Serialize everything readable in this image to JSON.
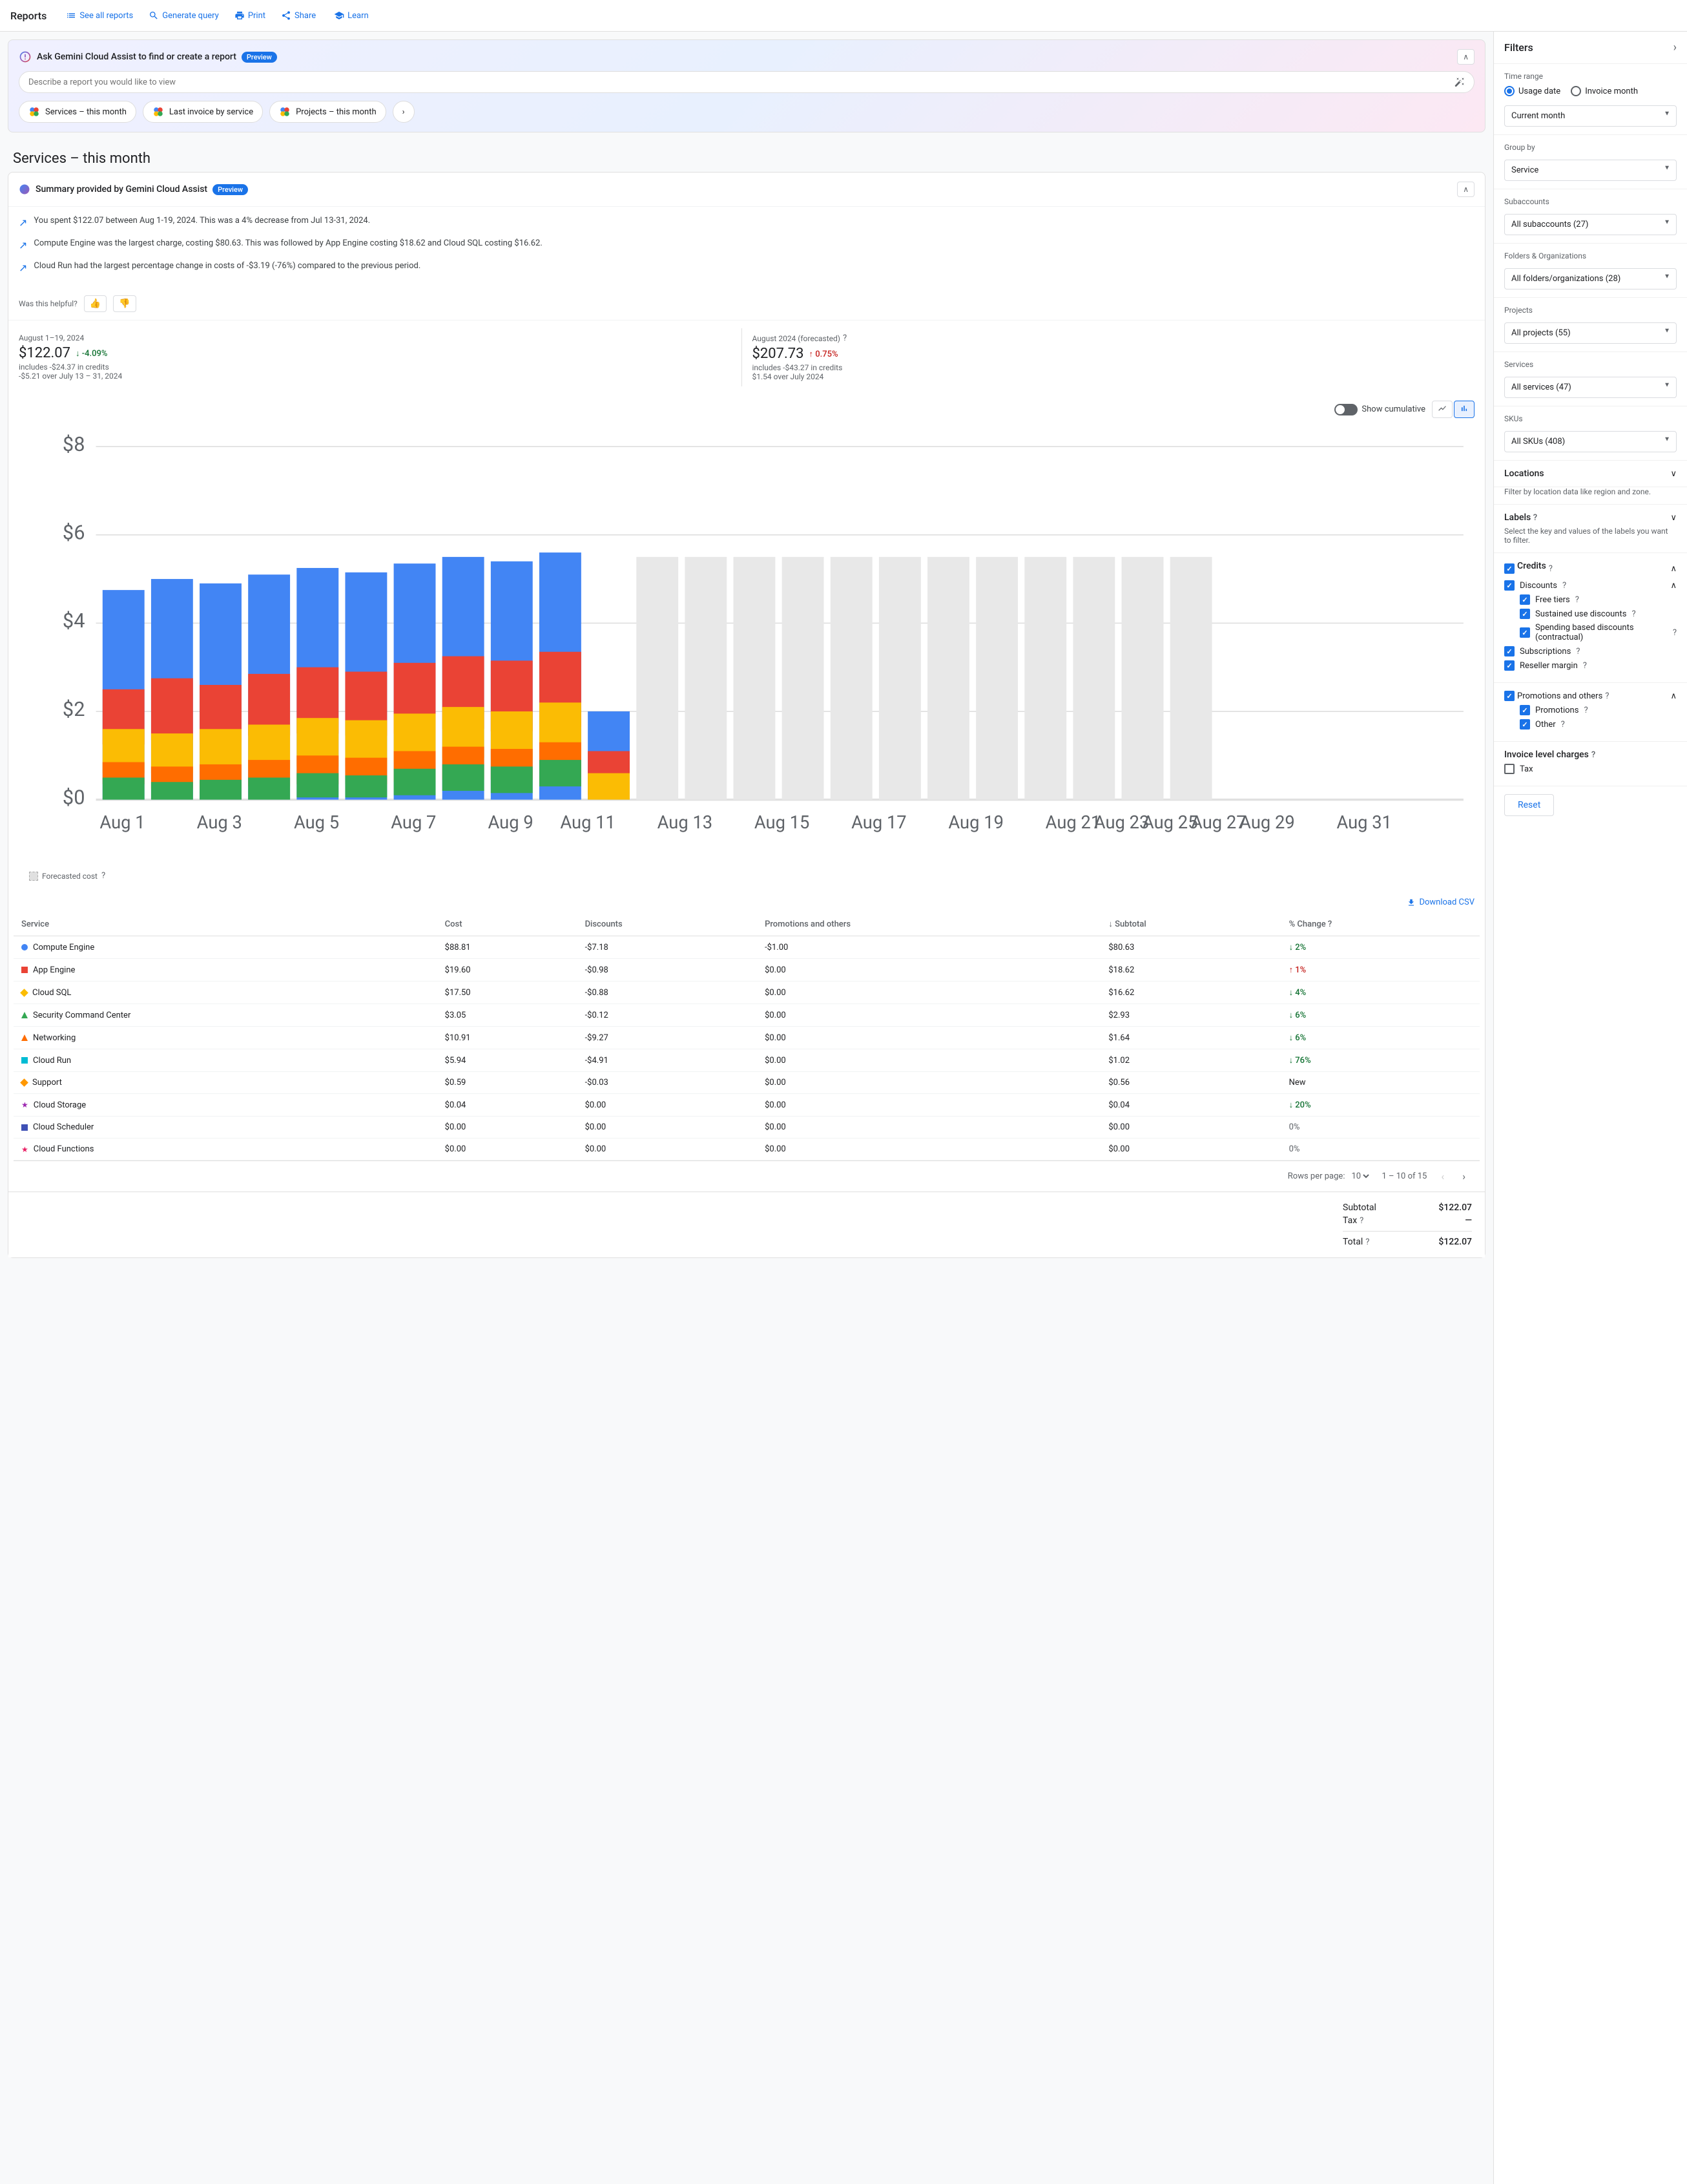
{
  "nav": {
    "brand": "Reports",
    "links": [
      {
        "id": "see-all-reports",
        "label": "See all reports",
        "icon": "list"
      },
      {
        "id": "generate-query",
        "label": "Generate query",
        "icon": "search"
      },
      {
        "id": "print",
        "label": "Print",
        "icon": "print"
      },
      {
        "id": "share",
        "label": "Share",
        "icon": "share"
      },
      {
        "id": "learn",
        "label": "Learn",
        "icon": "learn"
      }
    ]
  },
  "gemini": {
    "title": "Ask Gemini Cloud Assist to find or create a report",
    "preview_badge": "Preview",
    "input_placeholder": "Describe a report you would like to view",
    "quick_reports": [
      {
        "id": "services-month",
        "label": "Services – this month"
      },
      {
        "id": "last-invoice",
        "label": "Last invoice by service"
      },
      {
        "id": "projects-month",
        "label": "Projects – this month"
      }
    ]
  },
  "page_title": "Services – this month",
  "summary": {
    "title": "Summary provided by Gemini Cloud Assist",
    "preview_badge": "Preview",
    "bullets": [
      "You spent $122.07 between Aug 1-19, 2024. This was a 4% decrease from Jul 13-31, 2024.",
      "Compute Engine was the largest charge, costing $80.63. This was followed by App Engine costing $18.62 and Cloud SQL costing $16.62.",
      "Cloud Run had the largest percentage change in costs of -$3.19 (-76%) compared to the previous period."
    ],
    "helpful_label": "Was this helpful?",
    "thumb_up": "👍",
    "thumb_down": "👎"
  },
  "stats": {
    "current": {
      "period": "August 1–19, 2024",
      "amount": "$122.07",
      "change_pct": "-4.09%",
      "change_dir": "down",
      "note": "includes -$24.37 in credits",
      "change_note": "-$5.21 over July 13 – 31, 2024"
    },
    "forecasted": {
      "period": "August 2024 (forecasted)",
      "amount": "$207.73",
      "change_pct": "0.75%",
      "change_dir": "up",
      "note": "includes -$43.27 in credits",
      "change_note": "$1.54 over July 2024"
    }
  },
  "chart": {
    "show_cumulative_label": "Show cumulative",
    "y_labels": [
      "$8",
      "$6",
      "$4",
      "$2",
      "$0"
    ],
    "x_labels": [
      "Aug 1",
      "Aug 3",
      "Aug 5",
      "Aug 7",
      "Aug 9",
      "Aug 11",
      "Aug 13",
      "Aug 15",
      "Aug 17",
      "Aug 19",
      "Aug 21",
      "Aug 23",
      "Aug 25",
      "Aug 27",
      "Aug 29",
      "Aug 31"
    ],
    "forecasted_cost_label": "Forecasted cost"
  },
  "table": {
    "download_csv": "Download CSV",
    "columns": [
      "Service",
      "Cost",
      "Discounts",
      "Promotions and others",
      "Subtotal",
      "% Change"
    ],
    "rows": [
      {
        "service": "Compute Engine",
        "color": "#4285F4",
        "shape": "circle",
        "cost": "$88.81",
        "discounts": "-$7.18",
        "promotions": "-$1.00",
        "subtotal": "$80.63",
        "change": "2%",
        "dir": "down"
      },
      {
        "service": "App Engine",
        "color": "#EA4335",
        "shape": "square",
        "cost": "$19.60",
        "discounts": "-$0.98",
        "promotions": "$0.00",
        "subtotal": "$18.62",
        "change": "1%",
        "dir": "up"
      },
      {
        "service": "Cloud SQL",
        "color": "#FBBC04",
        "shape": "diamond",
        "cost": "$17.50",
        "discounts": "-$0.88",
        "promotions": "$0.00",
        "subtotal": "$16.62",
        "change": "4%",
        "dir": "down"
      },
      {
        "service": "Security Command Center",
        "color": "#34A853",
        "shape": "triangle",
        "cost": "$3.05",
        "discounts": "-$0.12",
        "promotions": "$0.00",
        "subtotal": "$2.93",
        "change": "6%",
        "dir": "down"
      },
      {
        "service": "Networking",
        "color": "#FF6D00",
        "shape": "triangle",
        "cost": "$10.91",
        "discounts": "-$9.27",
        "promotions": "$0.00",
        "subtotal": "$1.64",
        "change": "6%",
        "dir": "down"
      },
      {
        "service": "Cloud Run",
        "color": "#00BCD4",
        "shape": "square",
        "cost": "$5.94",
        "discounts": "-$4.91",
        "promotions": "$0.00",
        "subtotal": "$1.02",
        "change": "76%",
        "dir": "down"
      },
      {
        "service": "Support",
        "color": "#FF9800",
        "shape": "diamond",
        "cost": "$0.59",
        "discounts": "-$0.03",
        "promotions": "$0.00",
        "subtotal": "$0.56",
        "change": "New",
        "dir": "new"
      },
      {
        "service": "Cloud Storage",
        "color": "#9C27B0",
        "shape": "star",
        "cost": "$0.04",
        "discounts": "$0.00",
        "promotions": "$0.00",
        "subtotal": "$0.04",
        "change": "20%",
        "dir": "down"
      },
      {
        "service": "Cloud Scheduler",
        "color": "#3F51B5",
        "shape": "square",
        "cost": "$0.00",
        "discounts": "$0.00",
        "promotions": "$0.00",
        "subtotal": "$0.00",
        "change": "0%",
        "dir": "zero"
      },
      {
        "service": "Cloud Functions",
        "color": "#E91E63",
        "shape": "star",
        "cost": "$0.00",
        "discounts": "$0.00",
        "promotions": "$0.00",
        "subtotal": "$0.00",
        "change": "0%",
        "dir": "zero"
      }
    ],
    "pagination": {
      "rows_per_page": "10",
      "current_range": "1 – 10 of 15"
    }
  },
  "totals": {
    "subtotal_label": "Subtotal",
    "subtotal_value": "$122.07",
    "tax_label": "Tax",
    "tax_help": "?",
    "tax_value": "—",
    "total_label": "Total",
    "total_help": "?",
    "total_value": "$122.07"
  },
  "filters": {
    "title": "Filters",
    "time_range_label": "Time range",
    "usage_date_label": "Usage date",
    "invoice_month_label": "Invoice month",
    "current_month": "Current month",
    "group_by_label": "Group by",
    "group_by_value": "Service",
    "subaccounts_label": "Subaccounts",
    "subaccounts_value": "All subaccounts (27)",
    "folders_label": "Folders & Organizations",
    "folders_value": "All folders/organizations (28)",
    "projects_label": "Projects",
    "projects_value": "All projects (55)",
    "services_label": "Services",
    "services_value": "All services (47)",
    "skus_label": "SKUs",
    "skus_value": "All SKUs (408)",
    "locations_label": "Locations",
    "locations_desc": "Filter by location data like region and zone.",
    "labels_label": "Labels",
    "labels_help": "?",
    "labels_desc": "Select the key and values of the labels you want to filter.",
    "credits_label": "Credits",
    "discounts_label": "Discounts",
    "discounts_help": "?",
    "free_tiers_label": "Free tiers",
    "free_tiers_help": "?",
    "sustained_label": "Sustained use discounts",
    "sustained_help": "?",
    "spending_label": "Spending based discounts (contractual)",
    "spending_help": "?",
    "subscriptions_label": "Subscriptions",
    "subscriptions_help": "?",
    "reseller_label": "Reseller margin",
    "reseller_help": "?",
    "promotions_label": "Promotions and others",
    "promotions_help": "?",
    "promotions_sub_label": "Promotions",
    "promotions_sub_help": "?",
    "other_label": "Other",
    "other_help": "?",
    "invoice_charges_label": "Invoice level charges",
    "invoice_charges_help": "?",
    "tax_label": "Tax",
    "reset_label": "Reset"
  }
}
